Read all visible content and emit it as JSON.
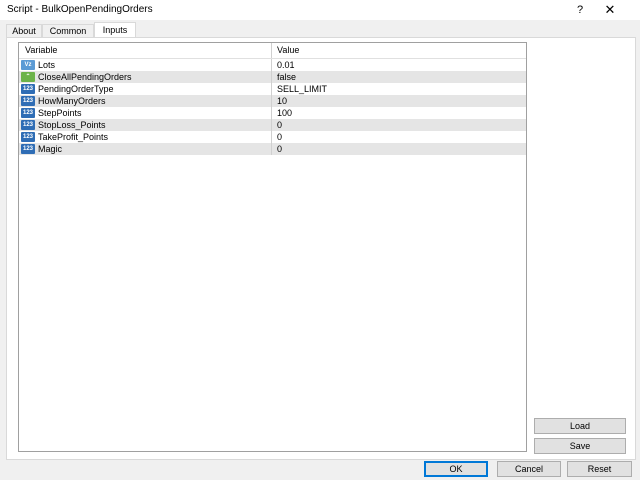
{
  "window": {
    "title": "Script - BulkOpenPendingOrders",
    "help_label": "?",
    "close_label": "✕"
  },
  "tabs": [
    {
      "label": "About"
    },
    {
      "label": "Common"
    },
    {
      "label": "Inputs"
    }
  ],
  "active_tab": "Inputs",
  "grid": {
    "columns": [
      "Variable",
      "Value"
    ],
    "rows": [
      {
        "icon": "double-type-icon",
        "icon_glyph": "Vz",
        "name": "Lots",
        "value": "0.01"
      },
      {
        "icon": "boolean-type-icon",
        "icon_glyph": "⌃",
        "name": "CloseAllPendingOrders",
        "value": "false"
      },
      {
        "icon": "integer-type-icon",
        "icon_glyph": "123",
        "name": "PendingOrderType",
        "value": "SELL_LIMIT"
      },
      {
        "icon": "integer-type-icon",
        "icon_glyph": "123",
        "name": "HowManyOrders",
        "value": "10"
      },
      {
        "icon": "integer-type-icon",
        "icon_glyph": "123",
        "name": "StepPoints",
        "value": "100"
      },
      {
        "icon": "integer-type-icon",
        "icon_glyph": "123",
        "name": "StopLoss_Points",
        "value": "0"
      },
      {
        "icon": "integer-type-icon",
        "icon_glyph": "123",
        "name": "TakeProfit_Points",
        "value": "0"
      },
      {
        "icon": "integer-type-icon",
        "icon_glyph": "123",
        "name": "Magic",
        "value": "0"
      }
    ]
  },
  "side_buttons": {
    "load": "Load",
    "save": "Save"
  },
  "footer": {
    "ok": "OK",
    "cancel": "Cancel",
    "reset": "Reset"
  }
}
